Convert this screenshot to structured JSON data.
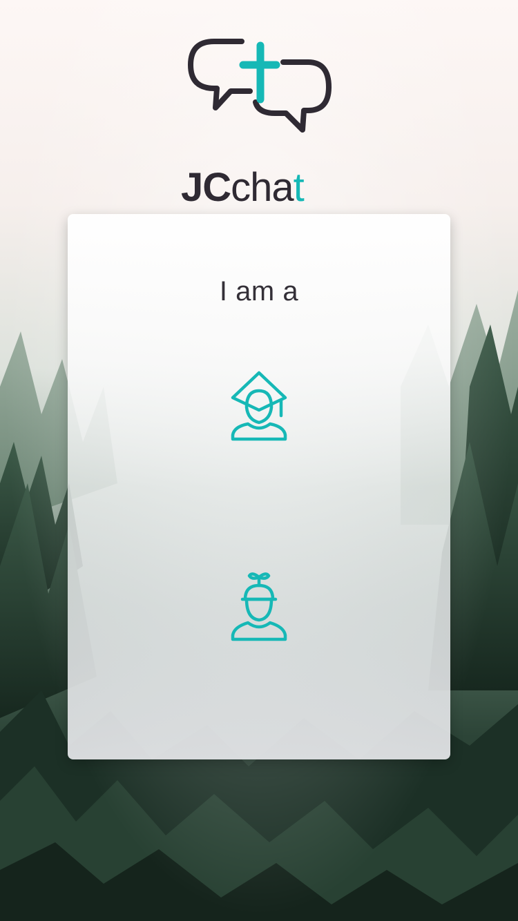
{
  "brand": {
    "name_part1": "JC",
    "name_part2": "cha",
    "name_part3": "t",
    "dark_color": "#2f2a33",
    "accent_color": "#16b8b6"
  },
  "card": {
    "title": "I am a",
    "options": [
      {
        "icon": "graduate-person-icon"
      },
      {
        "icon": "propeller-cap-child-icon"
      }
    ]
  }
}
